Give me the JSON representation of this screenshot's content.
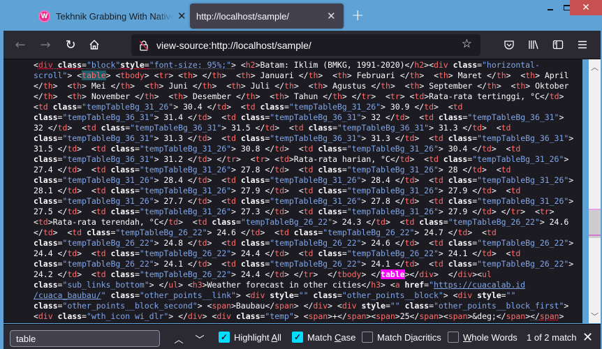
{
  "browser": {
    "tabs": [
      {
        "title": "Tekhnik Grabbing With Native P",
        "favicon": "wampserver-w-icon",
        "active": false
      },
      {
        "title": "http://localhost/sample/",
        "active": true
      }
    ],
    "new_tab_label": "+",
    "window_controls": {
      "minimize": "minimize",
      "maximize": "maximize",
      "close": "close"
    },
    "url": "view-source:http://localhost/sample/",
    "nav": {
      "back": "back-icon",
      "forward": "forward-icon",
      "reload": "reload-icon",
      "home": "home-icon"
    },
    "toolbar_icons": [
      "pocket-icon",
      "library-icon",
      "sidebar-icon",
      "menu-icon"
    ]
  },
  "source_lines": [
    "line-1",
    "line-2"
  ],
  "table_data": {
    "title": "Batam: Iklim (BMKG, 1991-2020)",
    "headers": [
      "",
      "Januari",
      "Februari",
      "Maret",
      "April",
      "Mei",
      "Juni",
      "Juli",
      "Agustus",
      "September",
      "Oktober",
      "November",
      "Desember",
      "Tahun"
    ],
    "rows": [
      {
        "label": "Rata-rata tertinggi, °C",
        "values": [
          "30.4",
          "30.9",
          "31.4",
          "32",
          "32",
          "31.5",
          "31.3",
          "31.3",
          "31.3",
          "31.5",
          "30.8",
          "30.4",
          "31.2"
        ]
      },
      {
        "label": "Rata-rata harian, °C",
        "values": [
          "27.4",
          "27.8",
          "28",
          "28.4",
          "28.4",
          "28.1",
          "27.9",
          "27.9",
          "27.7",
          "27.8",
          "27.5",
          "27.3",
          "27.9"
        ]
      },
      {
        "label": "Rata-rata terendah, °C",
        "values": [
          "24.3",
          "24.6",
          "24.6",
          "24.7",
          "24.8",
          "24.6",
          "24.4",
          "24.4",
          "24.1",
          "24.1",
          "24.1",
          "24.2",
          "24.4"
        ]
      }
    ],
    "other": {
      "forecast_heading": "Weather forecast in other cities",
      "link": "https://cuacalab.id/cuaca_baubau/",
      "city": "Baubau",
      "temp": [
        "+",
        "25",
        "&deg;"
      ]
    }
  },
  "find_bar": {
    "query": "table",
    "prev_label": "previous-match",
    "next_label": "next-match",
    "options": [
      {
        "label_pre": "Highlight ",
        "label_u": "A",
        "label_post": "ll",
        "checked": true
      },
      {
        "label_pre": "Match ",
        "label_u": "C",
        "label_post": "ase",
        "checked": true
      },
      {
        "label_pre": "Match D",
        "label_u": "i",
        "label_post": "acritics",
        "checked": false
      },
      {
        "label_pre": "",
        "label_u": "W",
        "label_post": "hole Words",
        "checked": false
      }
    ],
    "match_status": "1 of 2 match"
  },
  "colors": {
    "highlight_all": "#1d5e6a",
    "current_match": "#ff00ff",
    "checkbox_on": "#00ddff",
    "close_button": "#c75050",
    "titlebar": "#5ea2d6"
  }
}
